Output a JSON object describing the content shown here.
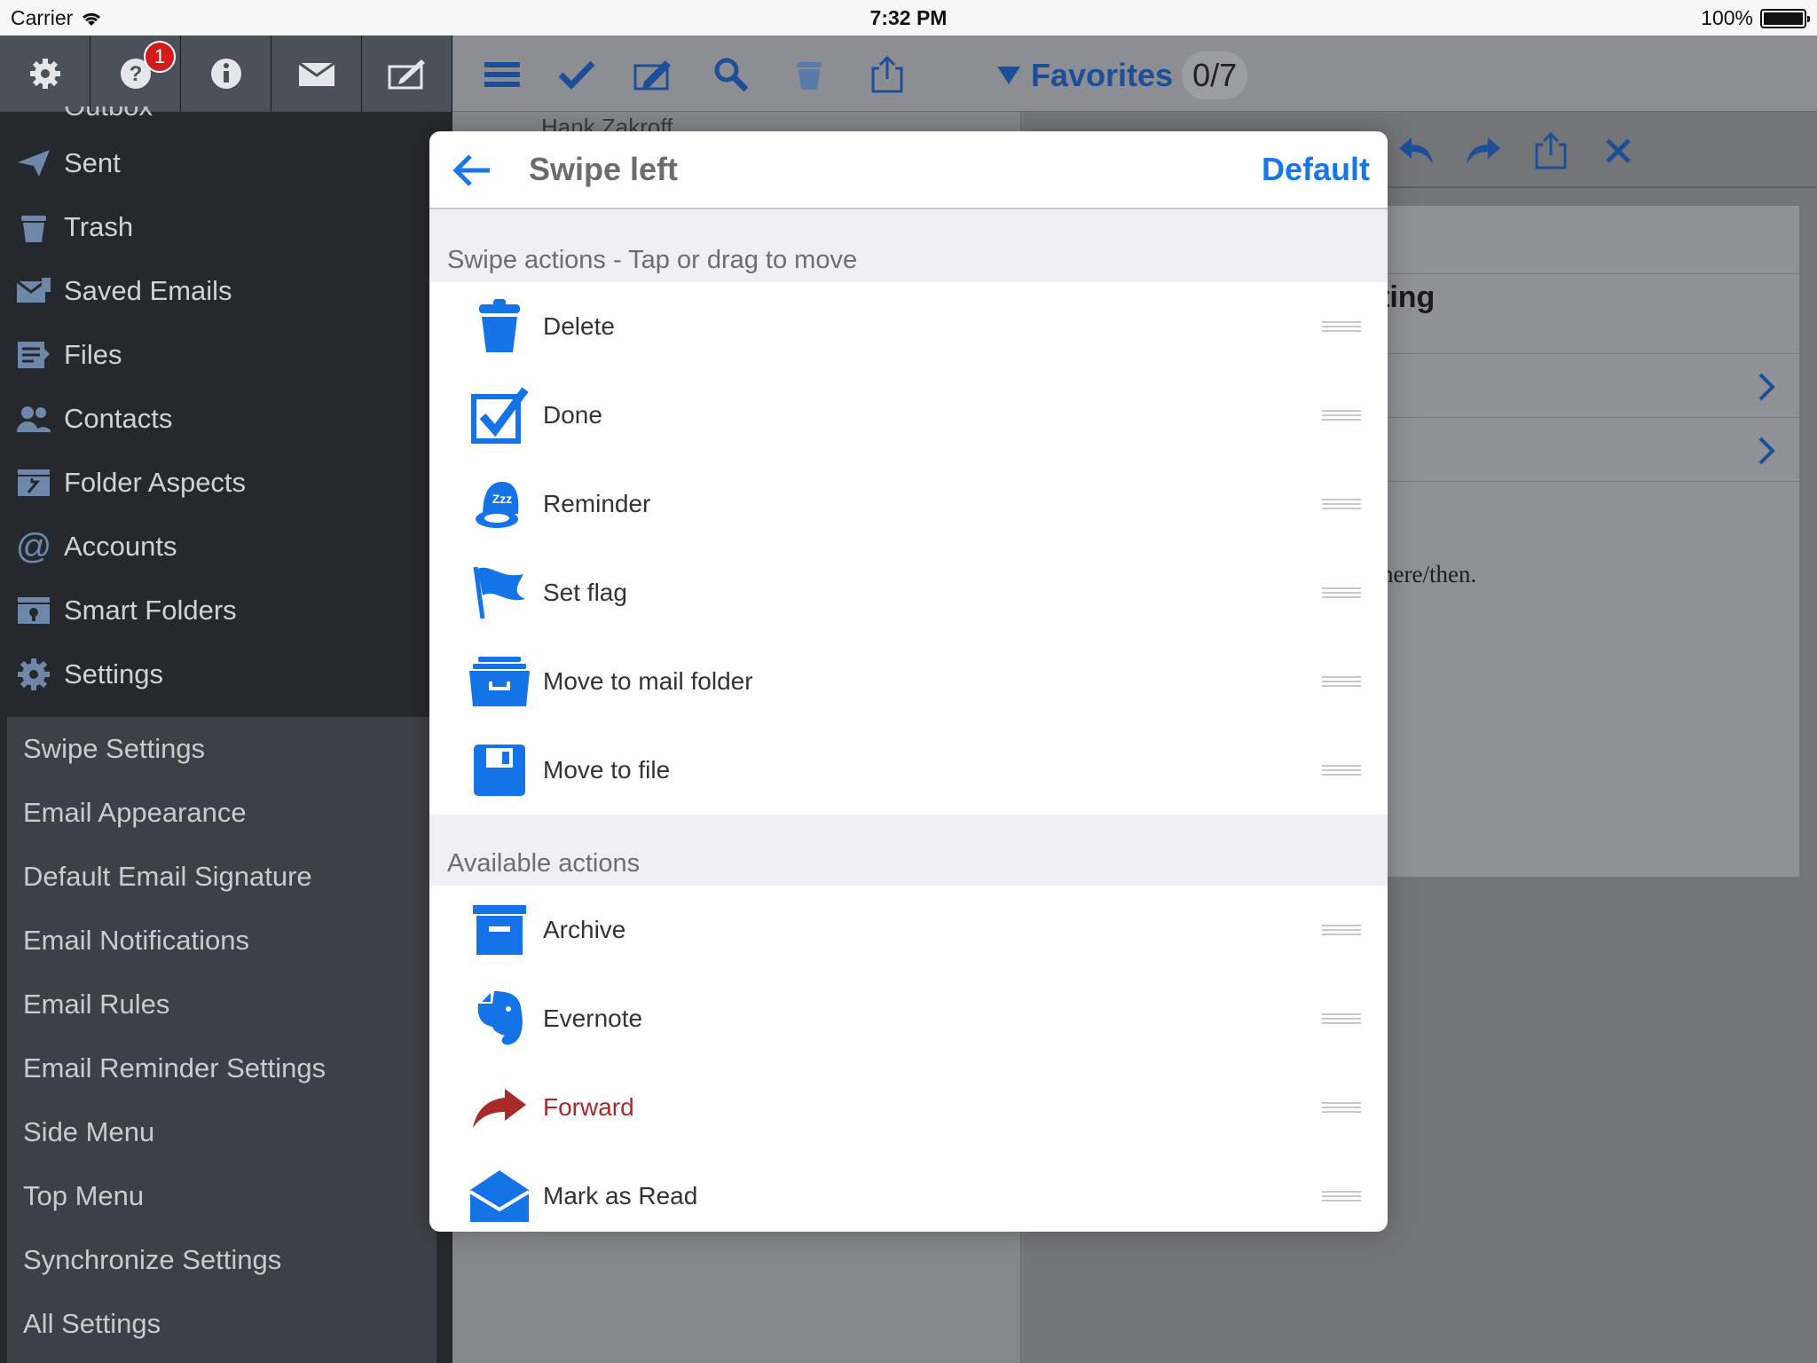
{
  "status_bar": {
    "carrier": "Carrier",
    "time": "7:32 PM",
    "battery": "100%"
  },
  "sidebar": {
    "top_icons": [
      {
        "icon": "gear-icon"
      },
      {
        "icon": "help-icon",
        "badge": "1"
      },
      {
        "icon": "info-icon"
      },
      {
        "icon": "envelope-icon"
      },
      {
        "icon": "compose-icon"
      }
    ],
    "partial_folder": "Outbox",
    "folders": [
      {
        "label": "Sent",
        "icon": "sent-icon"
      },
      {
        "label": "Trash",
        "icon": "trash-icon"
      },
      {
        "label": "Saved Emails",
        "icon": "saved-emails-icon"
      },
      {
        "label": "Files",
        "icon": "files-icon"
      },
      {
        "label": "Contacts",
        "icon": "contacts-icon"
      },
      {
        "label": "Folder Aspects",
        "icon": "folder-aspects-icon"
      },
      {
        "label": "Accounts",
        "icon": "at-icon"
      },
      {
        "label": "Smart Folders",
        "icon": "smart-folder-icon"
      },
      {
        "label": "Settings",
        "icon": "settings-icon"
      }
    ],
    "settings_items": [
      "Swipe Settings",
      "Email Appearance",
      "Default Email Signature",
      "Email Notifications",
      "Email Rules",
      "Email Reminder Settings",
      "Side Menu",
      "Top Menu",
      "Synchronize Settings",
      "All Settings"
    ]
  },
  "toolbar": {
    "favorites_label": "Favorites",
    "favorites_count": "0/7"
  },
  "list": {
    "peek_sender": "Hank Zakroff"
  },
  "detail": {
    "heading_fragment": "ting",
    "snippet_fragment": "nere/then."
  },
  "modal": {
    "title": "Swipe left",
    "default_label": "Default",
    "swipe_section": "Swipe actions - Tap or drag to move",
    "swipe_actions": [
      {
        "label": "Delete",
        "icon": "trash-can-icon"
      },
      {
        "label": "Done",
        "icon": "checkbox-icon"
      },
      {
        "label": "Reminder",
        "icon": "reminder-bell-icon"
      },
      {
        "label": "Set flag",
        "icon": "flag-icon"
      },
      {
        "label": "Move to mail folder",
        "icon": "mail-folder-icon"
      },
      {
        "label": "Move to file",
        "icon": "floppy-disk-icon"
      }
    ],
    "available_section": "Available actions",
    "available_actions": [
      {
        "label": "Archive",
        "icon": "archive-box-icon"
      },
      {
        "label": "Evernote",
        "icon": "evernote-icon"
      },
      {
        "label": "Forward",
        "icon": "forward-arrow-icon",
        "color": "#a82a2a"
      },
      {
        "label": "Mark as Read",
        "icon": "open-envelope-icon"
      }
    ]
  },
  "colors": {
    "accent": "#1877e8",
    "forward": "#a82a2a",
    "sidebar": "#25282d"
  }
}
